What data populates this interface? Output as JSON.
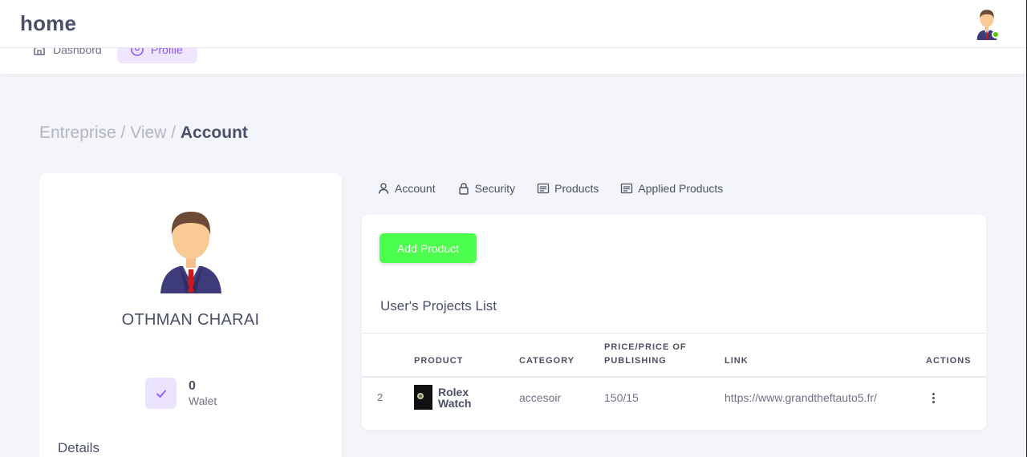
{
  "header": {
    "title": "home"
  },
  "subnav": {
    "items": [
      {
        "label": "Dashbord"
      },
      {
        "label": "Profile"
      }
    ]
  },
  "breadcrumb": {
    "first": "Entreprise",
    "sep1": " / ",
    "second": "View",
    "sep2": " / ",
    "current": "Account"
  },
  "profile": {
    "name": "OTHMAN CHARAI",
    "stat": {
      "value": "0",
      "label": "Walet"
    },
    "details_title": "Details"
  },
  "tabs": [
    {
      "label": "Account",
      "icon": "user-icon"
    },
    {
      "label": "Security",
      "icon": "lock-icon"
    },
    {
      "label": "Products",
      "icon": "list-icon"
    },
    {
      "label": "Applied Products",
      "icon": "list-icon"
    }
  ],
  "main": {
    "add_button": "Add Product",
    "list_title": "User's Projects List",
    "columns": {
      "product": "PRODUCT",
      "category": "CATEGORY",
      "price_1": "PRICE/PRICE OF",
      "price_2": "PUBLISHING",
      "link": "LINK",
      "actions": "ACTIONS"
    },
    "rows": [
      {
        "id": "2",
        "product_line1": "Rolex",
        "product_line2": "Watch",
        "category": "accesoir",
        "price": "150/15",
        "link": "https://www.grandtheftauto5.fr/"
      }
    ]
  },
  "colors": {
    "accent": "#9155fd",
    "add_button": "#4dff4d",
    "online": "#56ca00"
  }
}
